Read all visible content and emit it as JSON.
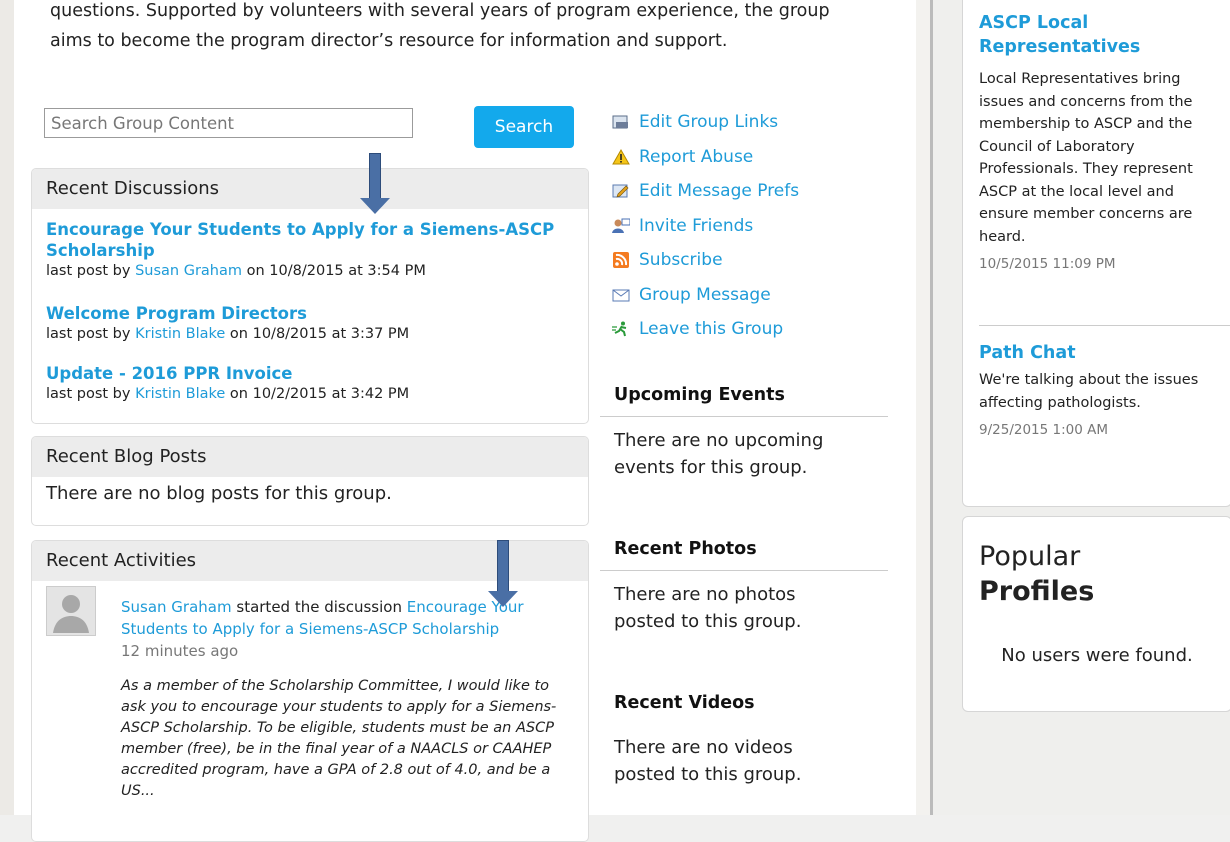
{
  "intro": {
    "line1": "questions. Supported by volunteers with several years of program experience, the group",
    "line2": "aims to become the program director’s resource for information and support."
  },
  "search": {
    "placeholder": "Search Group Content",
    "button": "Search"
  },
  "discussions": {
    "heading": "Recent Discussions",
    "items": [
      {
        "title_l1": "Encourage Your Students to Apply for a Siemens-ASCP",
        "title_l2": "Scholarship",
        "prefix": "last post by ",
        "author": "Susan Graham",
        "suffix": " on 10/8/2015 at 3:54 PM"
      },
      {
        "title_l1": "Welcome Program Directors",
        "prefix": "last post by ",
        "author": "Kristin Blake",
        "suffix": " on 10/8/2015 at 3:37 PM"
      },
      {
        "title_l1": "Update - 2016 PPR Invoice",
        "prefix": "last post by ",
        "author": "Kristin Blake",
        "suffix": " on 10/2/2015 at 3:42 PM"
      }
    ]
  },
  "blog": {
    "heading": "Recent Blog Posts",
    "empty": "There are no blog posts for this group."
  },
  "activities": {
    "heading": "Recent Activities",
    "item": {
      "actor": "Susan Graham",
      "verb": " started the discussion ",
      "target_l1": "Encourage Your",
      "target_l2": "Students to Apply for a Siemens-ASCP Scholarship",
      "ago": "12 minutes ago",
      "excerpt": "As a member of the Scholarship Committee, I would like to ask you to encourage your students to apply for a Siemens-ASCP Scholarship. To be eligible, students must be an ASCP member (free), be in the final year of a NAACLS or CAAHEP accredited program, have a GPA of 2.8 out of 4.0, and be a US..."
    }
  },
  "group_links": [
    {
      "label": "Edit Group Links",
      "icon": "edit-links-icon"
    },
    {
      "label": "Report Abuse",
      "icon": "warning-icon"
    },
    {
      "label": "Edit Message Prefs",
      "icon": "pencil-icon"
    },
    {
      "label": "Invite Friends",
      "icon": "invite-icon"
    },
    {
      "label": "Subscribe",
      "icon": "rss-icon"
    },
    {
      "label": "Group Message",
      "icon": "envelope-icon"
    },
    {
      "label": "Leave this Group",
      "icon": "running-man-icon"
    }
  ],
  "events": {
    "heading": "Upcoming Events",
    "empty_l1": "There are no upcoming",
    "empty_l2": "events for this group."
  },
  "photos": {
    "heading": "Recent Photos",
    "empty_l1": "There are no photos",
    "empty_l2": "posted to this group."
  },
  "videos": {
    "heading": "Recent Videos",
    "empty_l1": "There are no videos",
    "empty_l2": "posted to this group."
  },
  "sidebar": {
    "communities": [
      {
        "title_l1": "ASCP Local",
        "title_l2": "Representatives",
        "desc": [
          "Local Representatives bring",
          "issues and concerns from the",
          "membership to ASCP and the",
          "Council of Laboratory",
          "Professionals. They represent",
          "ASCP at the local level and",
          "ensure member concerns are",
          "heard."
        ],
        "date": "10/5/2015 11:09 PM"
      },
      {
        "title_l1": "Path Chat",
        "desc": [
          "We're talking about the issues",
          "affecting pathologists."
        ],
        "date": "9/25/2015 1:00 AM"
      }
    ],
    "popular": {
      "title_l1": "Popular",
      "title_l2": "Profiles",
      "empty": "No users were found."
    }
  },
  "colors": {
    "link": "#1e9bd8",
    "button": "#13a9ec",
    "arrow": "#4a6fa5"
  }
}
